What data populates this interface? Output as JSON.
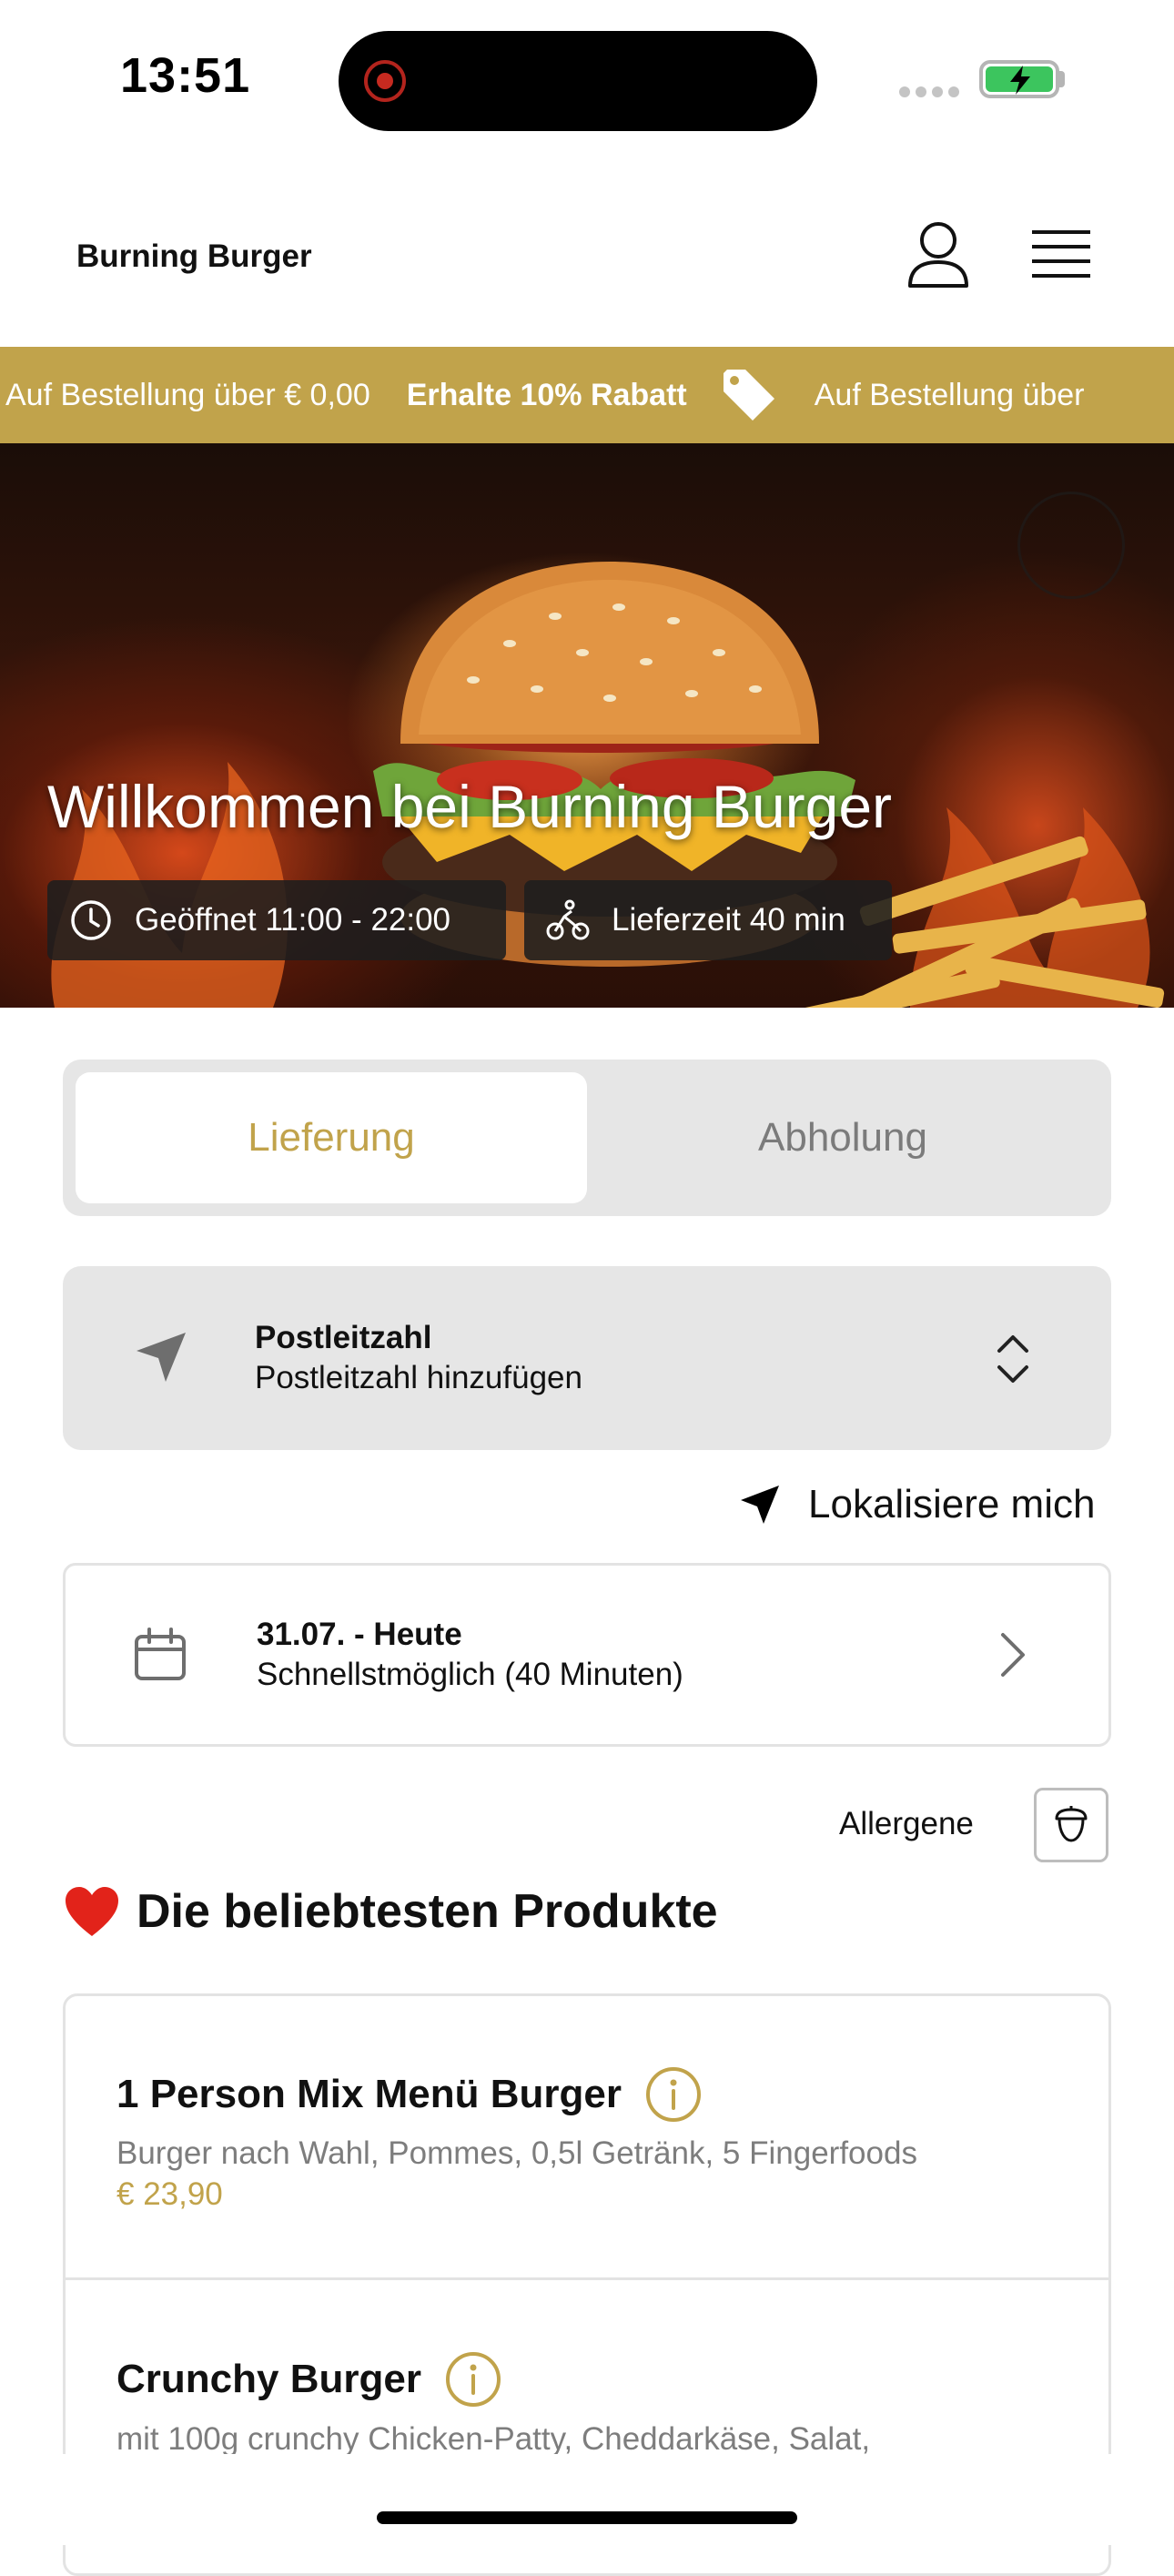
{
  "status_bar": {
    "time": "13:51"
  },
  "header": {
    "brand": "Burning Burger"
  },
  "promo": {
    "text_min_order": "Auf Bestellung über € 0,00",
    "text_discount": "Erhalte 10% Rabatt",
    "text_repeat": "Auf Bestellung über"
  },
  "hero": {
    "title": "Willkommen bei Burning Burger",
    "opening_hours": "Geöffnet 11:00 - 22:00",
    "delivery_time": "Lieferzeit 40 min"
  },
  "tabs": {
    "delivery": "Lieferung",
    "pickup": "Abholung",
    "active": "delivery"
  },
  "postcode": {
    "label": "Postleitzahl",
    "placeholder": "Postleitzahl hinzufügen"
  },
  "locate": {
    "label": "Lokalisiere mich"
  },
  "schedule": {
    "date": "31.07. - Heute",
    "time": "Schnellstmöglich (40 Minuten)"
  },
  "allergens": {
    "label": "Allergene"
  },
  "section": {
    "emoji": "❤️",
    "title": "Die beliebtesten Produkte"
  },
  "products": [
    {
      "name": "1 Person Mix Menü Burger",
      "description": "Burger nach Wahl, Pommes, 0,5l Getränk, 5 Fingerfoods",
      "price": "€ 23,90"
    },
    {
      "name": "Crunchy Burger",
      "description": "mit 100g crunchy Chicken-Patty, Cheddarkäse, Salat,",
      "price": ""
    }
  ],
  "colors": {
    "accent": "#c1a34b",
    "panel": "#e6e6e6",
    "border": "#e3e3e3"
  }
}
